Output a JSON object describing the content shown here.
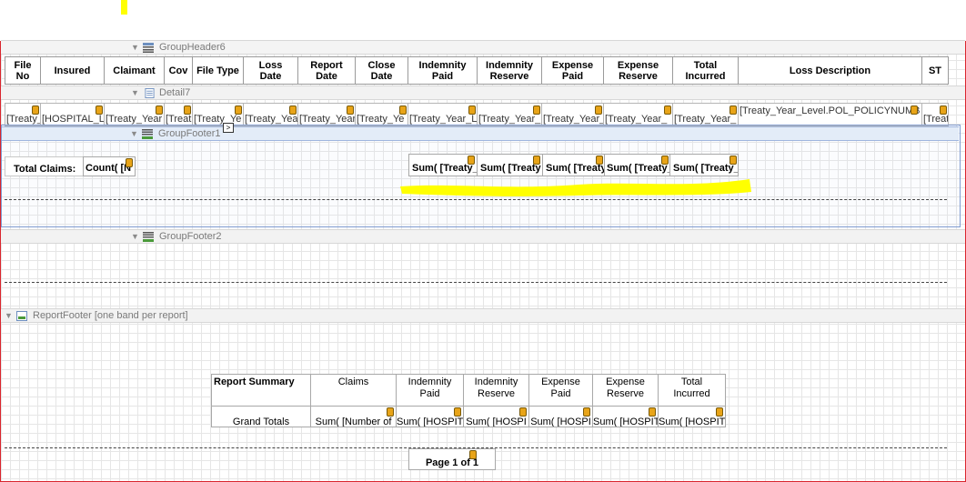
{
  "bands": {
    "group_header6": "GroupHeader6",
    "detail7": "Detail7",
    "group_footer1": "GroupFooter1",
    "group_footer2": "GroupFooter2",
    "report_footer": "ReportFooter [one band per report]"
  },
  "header_columns": [
    {
      "label1": "File",
      "label2": "No"
    },
    {
      "label1": "Insured",
      "label2": ""
    },
    {
      "label1": "Claimant",
      "label2": ""
    },
    {
      "label1": "Cov",
      "label2": ""
    },
    {
      "label1": "File Type",
      "label2": ""
    },
    {
      "label1": "Loss",
      "label2": "Date"
    },
    {
      "label1": "Report",
      "label2": "Date"
    },
    {
      "label1": "Close",
      "label2": "Date"
    },
    {
      "label1": "Indemnity",
      "label2": "Paid"
    },
    {
      "label1": "Indemnity",
      "label2": "Reserve"
    },
    {
      "label1": "Expense",
      "label2": "Paid"
    },
    {
      "label1": "Expense",
      "label2": "Reserve"
    },
    {
      "label1": "Total",
      "label2": "Incurred"
    },
    {
      "label1": "Loss Description",
      "label2": ""
    },
    {
      "label1": "ST",
      "label2": ""
    }
  ],
  "detail_cells": [
    "[Treaty_",
    "[HOSPITAL_L",
    "[Treaty_Year",
    "[Treat",
    "[Treaty_Ye",
    "[Treaty_Yea",
    "[Treaty_Year",
    "[Treaty_Ye",
    "[Treaty_Year_L",
    "[Treaty_Year_",
    "[Treaty_Year_",
    "[Treaty_Year_",
    "[Treaty_Year_",
    "[Treaty_Year_Level.POL_POLICYNUMB",
    "[Treat"
  ],
  "group_footer1": {
    "total_claims_label": "Total Claims:",
    "count_expr": "Count( [N",
    "sums": [
      "Sum( [Treaty_",
      "Sum( [Treaty",
      "Sum( [Treaty",
      "Sum( [Treaty_",
      "Sum( [Treaty_"
    ]
  },
  "summary": {
    "title": "Report Summary",
    "columns": [
      {
        "label1": "Claims",
        "label2": ""
      },
      {
        "label1": "Indemnity",
        "label2": "Paid"
      },
      {
        "label1": "Indemnity",
        "label2": "Reserve"
      },
      {
        "label1": "Expense",
        "label2": "Paid"
      },
      {
        "label1": "Expense",
        "label2": "Reserve"
      },
      {
        "label1": "Total",
        "label2": "Incurred"
      }
    ],
    "grand_totals_label": "Grand Totals",
    "values": [
      "Sum( [Number of",
      "Sum( [HOSPIT",
      "Sum( [HOSPI",
      "Sum( [HOSPI",
      "Sum( [HOSPIT",
      "Sum( [HOSPIT"
    ]
  },
  "page_label": "Page  1 of 1",
  "colors": {
    "highlight": "#ffff00",
    "selection_border": "#5b7fc7",
    "surface_border": "#d9262e",
    "db_icon": "#e8a418"
  }
}
